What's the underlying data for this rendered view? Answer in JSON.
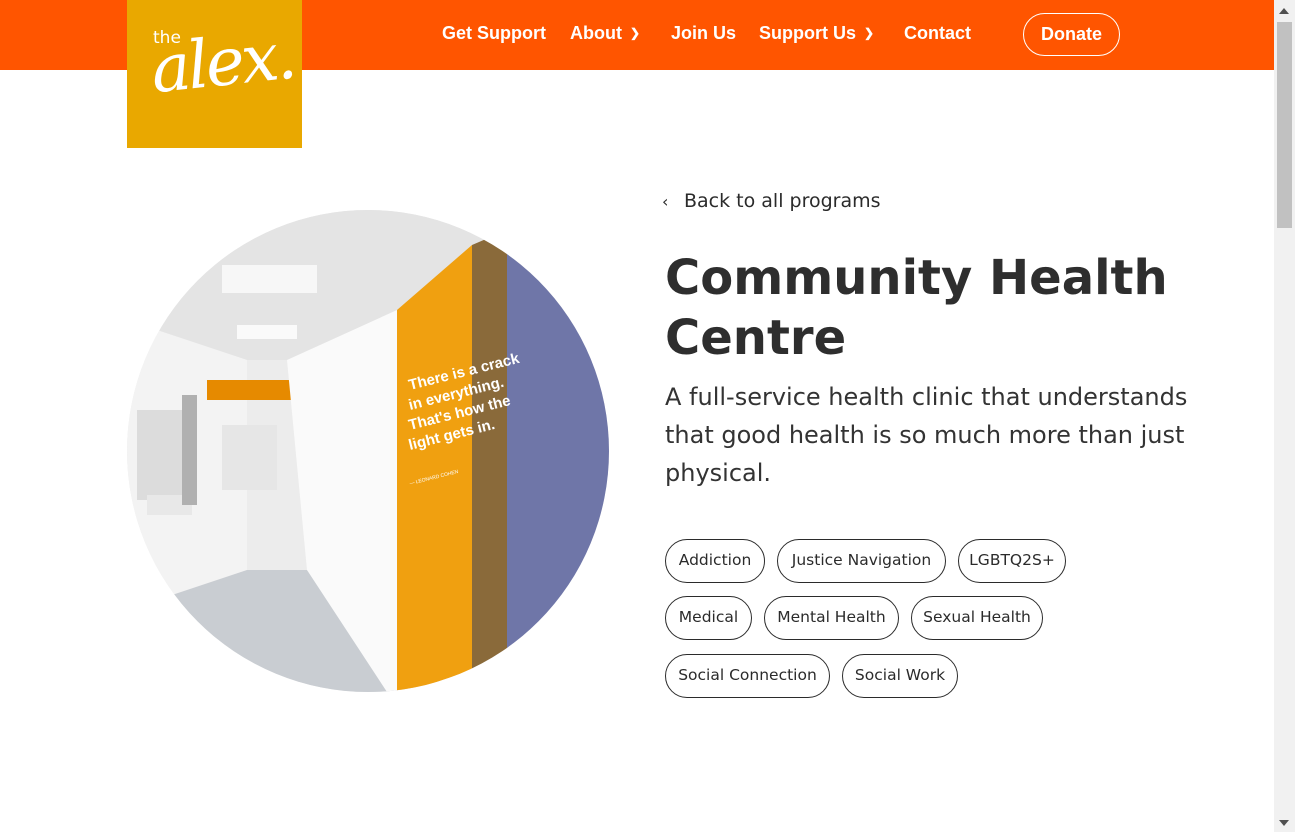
{
  "logo": {
    "small": "the",
    "large": "alex."
  },
  "nav": {
    "items": [
      {
        "label": "Get Support"
      },
      {
        "label": "About"
      },
      {
        "label": "Join Us"
      },
      {
        "label": "Support Us"
      },
      {
        "label": "Contact"
      }
    ],
    "donate_label": "Donate"
  },
  "back_link": {
    "label": "Back to all programs",
    "icon": "chevron-left-icon"
  },
  "program": {
    "title": "Community Health Centre",
    "description": "A full-service health clinic that understands that good health is so much more than just physical.",
    "tags": [
      "Addiction",
      "Justice Navigation",
      "LGBTQ2S+",
      "Medical",
      "Mental Health",
      "Sexual Health",
      "Social Connection",
      "Social Work"
    ]
  },
  "photo": {
    "wall_quote": [
      "There is a crack",
      "in everything.",
      "That's how the",
      "light gets in."
    ],
    "wall_attribution": "— LEONARD COHEN"
  },
  "colors": {
    "nav_bg": "#ff5500",
    "logo_bg": "#e9a800",
    "text": "#2b2b2b"
  }
}
